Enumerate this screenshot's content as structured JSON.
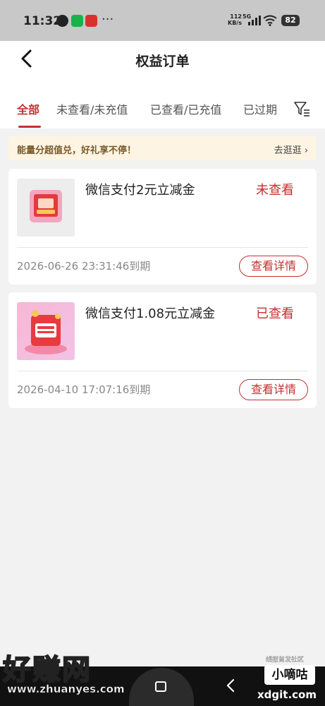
{
  "status_bar": {
    "time": "11:32",
    "more": "···",
    "net_speed_top": "112",
    "net_speed_bottom": "KB/s",
    "network": "5G",
    "battery": "82",
    "icons": [
      "qq-icon",
      "wechat-icon",
      "app-icon",
      "signal-icon",
      "wifi-icon",
      "battery-icon"
    ]
  },
  "header": {
    "title": "权益订单",
    "back_icon": "chevron-left-icon"
  },
  "tabs": [
    {
      "label": "全部",
      "active": true
    },
    {
      "label": "未查看/未充值",
      "active": false
    },
    {
      "label": "已查看/已充值",
      "active": false
    },
    {
      "label": "已过期",
      "active": false
    }
  ],
  "filter_icon": "filter-icon",
  "promo": {
    "text": "能量分超值兑，好礼享不停！",
    "link": "去逛逛 ›"
  },
  "orders": [
    {
      "title": "微信支付2元立减金",
      "status": "未查看",
      "expire": "2026-06-26 23:31:46到期",
      "button": "查看详情"
    },
    {
      "title": "微信支付1.08元立减金",
      "status": "已查看",
      "expire": "2026-04-10 17:07:16到期",
      "button": "查看详情"
    }
  ],
  "watermark": {
    "logo": "好赚网",
    "url": "www.zhuanyes.com",
    "tag_small": "线报首发社区",
    "tag": "小嘀咕",
    "site": "xdgit.com"
  },
  "colors": {
    "accent": "#c0322f",
    "promo_bg": "#fdf4e3",
    "page_bg": "#f2f2f2"
  }
}
